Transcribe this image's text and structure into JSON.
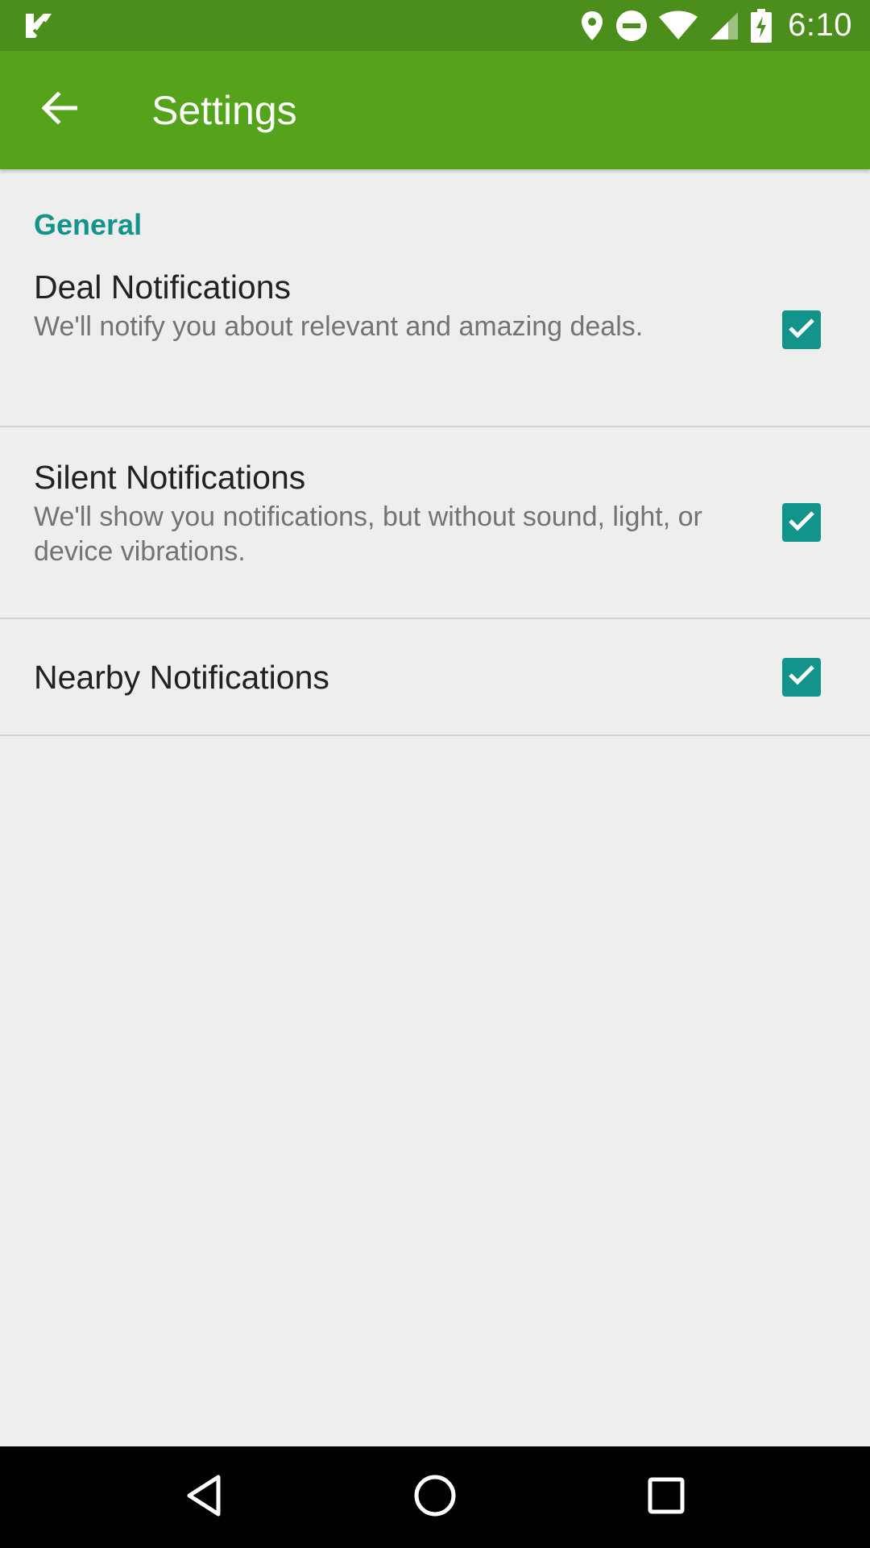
{
  "status_bar": {
    "time": "6:10",
    "icons": [
      "app-notification-icon",
      "location-icon",
      "do-not-disturb-icon",
      "wifi-icon",
      "cell-signal-icon",
      "battery-charging-icon"
    ]
  },
  "app_bar": {
    "title": "Settings",
    "back_icon": "arrow-back-icon",
    "color": "#55a31b"
  },
  "settings": {
    "section_title": "General",
    "items": [
      {
        "title": "Deal Notifications",
        "summary": "We'll notify you about relevant and amazing deals.",
        "checked": true
      },
      {
        "title": "Silent Notifications",
        "summary": "We'll show you notifications, but without sound, light, or device vibrations.",
        "checked": true
      },
      {
        "title": "Nearby Notifications",
        "summary": "",
        "checked": true
      }
    ]
  },
  "nav_bar": {
    "buttons": [
      "back-triangle-icon",
      "home-circle-icon",
      "recents-square-icon"
    ]
  },
  "colors": {
    "status_bar": "#4b8e1b",
    "accent": "#13948a",
    "background": "#eeeeee"
  }
}
